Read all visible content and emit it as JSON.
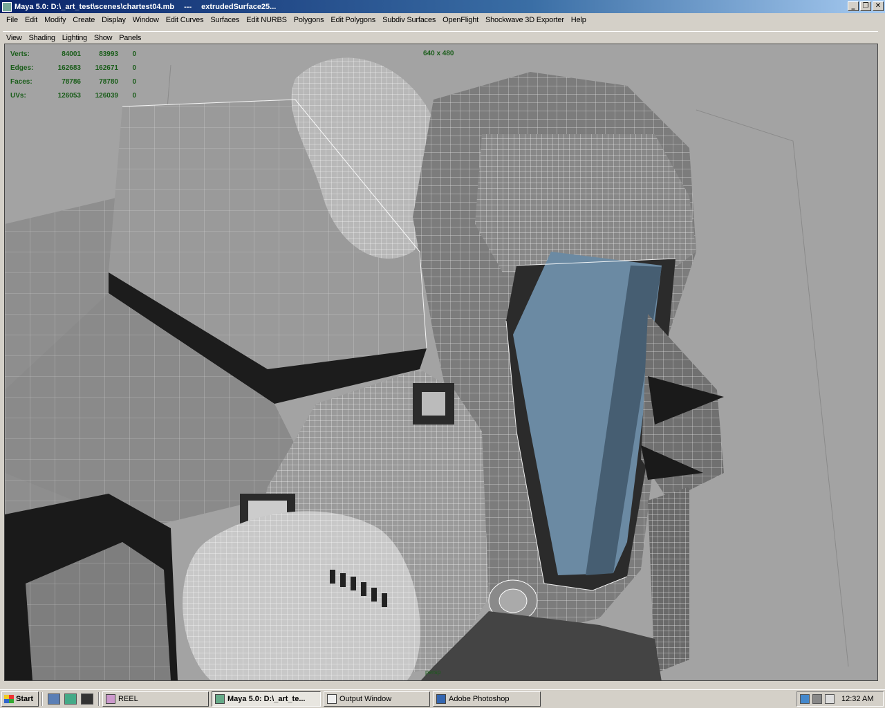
{
  "window": {
    "title": "Maya 5.0: D:\\_art_test\\scenes\\chartest04.mb",
    "title_sep": "---",
    "title_object": "extrudedSurface25...",
    "icon": "maya-app-icon",
    "minimize": "_",
    "restore": "❐",
    "close": "✕"
  },
  "menu": [
    "File",
    "Edit",
    "Modify",
    "Create",
    "Display",
    "Window",
    "Edit Curves",
    "Surfaces",
    "Edit NURBS",
    "Polygons",
    "Edit Polygons",
    "Subdiv Surfaces",
    "OpenFlight",
    "Shockwave 3D Exporter",
    "Help"
  ],
  "panel_menu": [
    "View",
    "Shading",
    "Lighting",
    "Show",
    "Panels"
  ],
  "hud": {
    "rows": [
      {
        "label": "Verts:",
        "a": "84001",
        "b": "83993",
        "c": "0"
      },
      {
        "label": "Edges:",
        "a": "162683",
        "b": "162671",
        "c": "0"
      },
      {
        "label": "Faces:",
        "a": "78786",
        "b": "78780",
        "c": "0"
      },
      {
        "label": "UVs:",
        "a": "126053",
        "b": "126039",
        "c": "0"
      }
    ],
    "resolution": "640 x 480",
    "axis": "persp"
  },
  "colors": {
    "viewport_bg": "#a3a3a3",
    "hud_text": "#1a5d1a",
    "visor": "#6b8aa3",
    "titlebar_start": "#0a246a"
  },
  "taskbar": {
    "start": "Start",
    "quick_launch": [
      "outlook-express-icon",
      "desktop-icon",
      "command-prompt-icon"
    ],
    "tasks": [
      {
        "label": "REEL",
        "icon": "folder-icon",
        "active": false
      },
      {
        "label": "Maya 5.0: D:\\_art_te...",
        "icon": "maya-icon",
        "active": true
      },
      {
        "label": "Output Window",
        "icon": "output-window-icon",
        "active": false
      },
      {
        "label": "Adobe Photoshop",
        "icon": "photoshop-icon",
        "active": false
      }
    ],
    "tray_icons": [
      "network-icon",
      "speaker-icon",
      "monitor-icon"
    ],
    "clock": "12:32 AM"
  }
}
